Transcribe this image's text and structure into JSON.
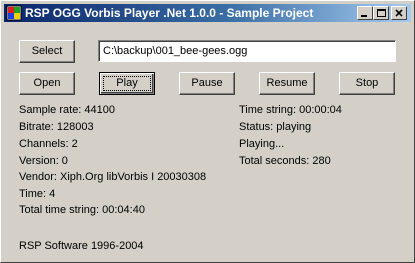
{
  "window": {
    "title": "RSP OGG Vorbis Player .Net 1.0.0 - Sample Project"
  },
  "controls": {
    "select_label": "Select",
    "file_path": "C:\\backup\\001_bee-gees.ogg",
    "open_label": "Open",
    "play_label": "Play",
    "pause_label": "Pause",
    "resume_label": "Resume",
    "stop_label": "Stop"
  },
  "info_left": [
    "Sample rate: 44100",
    "Bitrate: 128003",
    "Channels: 2",
    "Version: 0",
    "Vendor: Xiph.Org libVorbis I 20030308",
    "Time: 4",
    "Total time string: 00:04:40"
  ],
  "info_right": [
    "Time string: 00:00:04",
    "Status: playing",
    "Playing...",
    "Total seconds: 280"
  ],
  "footer": {
    "copyright": "RSP Software 1996-2004"
  },
  "colors": {
    "titlebar_start": "#0a246a",
    "titlebar_end": "#a6caf0",
    "face": "#d4d0c8"
  }
}
